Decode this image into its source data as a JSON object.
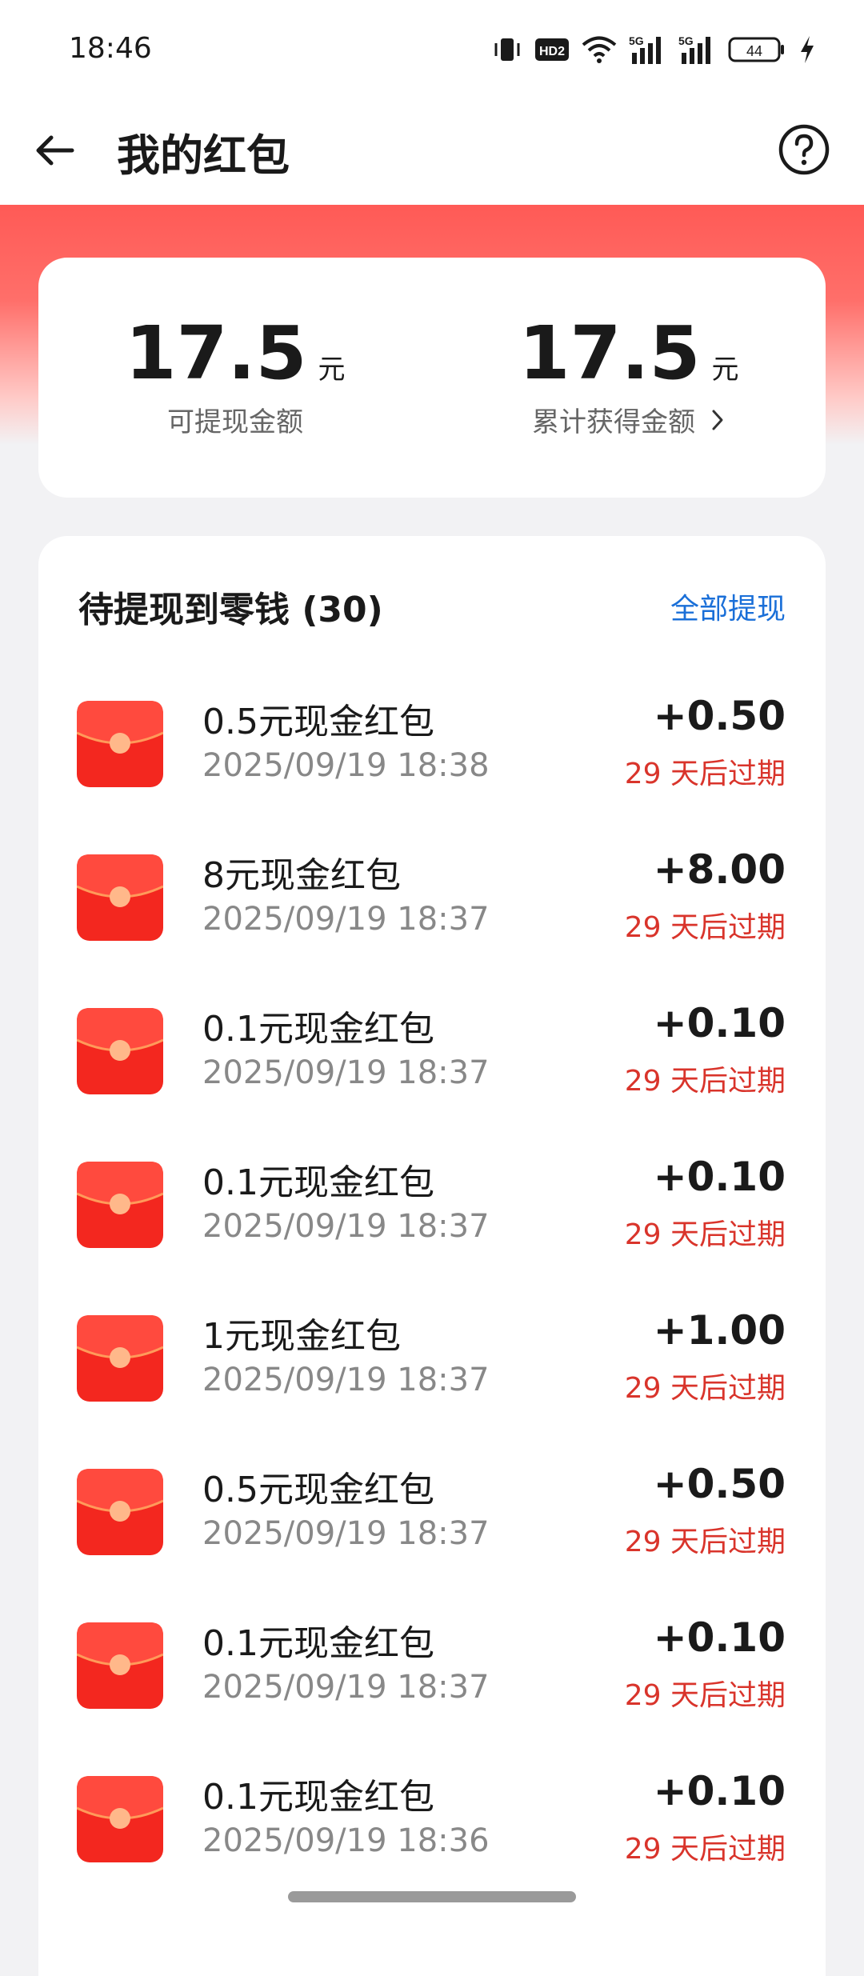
{
  "status_bar": {
    "time": "18:46",
    "battery": "44",
    "network1": "5G",
    "network2": "5G",
    "hd_badge": "HD2"
  },
  "header": {
    "title": "我的红包"
  },
  "summary": {
    "withdrawable_value": "17.5",
    "withdrawable_unit": "元",
    "withdrawable_label": "可提现金额",
    "total_value": "17.5",
    "total_unit": "元",
    "total_label": "累计获得金额"
  },
  "list": {
    "title": "待提现到零钱 (30)",
    "action": "全部提现",
    "items": [
      {
        "name": "0.5元现金红包",
        "time": "2025/09/19 18:38",
        "amount": "+0.50",
        "expire": "29 天后过期"
      },
      {
        "name": "8元现金红包",
        "time": "2025/09/19 18:37",
        "amount": "+8.00",
        "expire": "29 天后过期"
      },
      {
        "name": "0.1元现金红包",
        "time": "2025/09/19 18:37",
        "amount": "+0.10",
        "expire": "29 天后过期"
      },
      {
        "name": "0.1元现金红包",
        "time": "2025/09/19 18:37",
        "amount": "+0.10",
        "expire": "29 天后过期"
      },
      {
        "name": "1元现金红包",
        "time": "2025/09/19 18:37",
        "amount": "+1.00",
        "expire": "29 天后过期"
      },
      {
        "name": "0.5元现金红包",
        "time": "2025/09/19 18:37",
        "amount": "+0.50",
        "expire": "29 天后过期"
      },
      {
        "name": "0.1元现金红包",
        "time": "2025/09/19 18:37",
        "amount": "+0.10",
        "expire": "29 天后过期"
      },
      {
        "name": "0.1元现金红包",
        "time": "2025/09/19 18:36",
        "amount": "+0.10",
        "expire": "29 天后过期"
      }
    ]
  },
  "colors": {
    "accent_red": "#ff5a56",
    "expire_red": "#d9342b",
    "link_blue": "#1a6fd8"
  }
}
